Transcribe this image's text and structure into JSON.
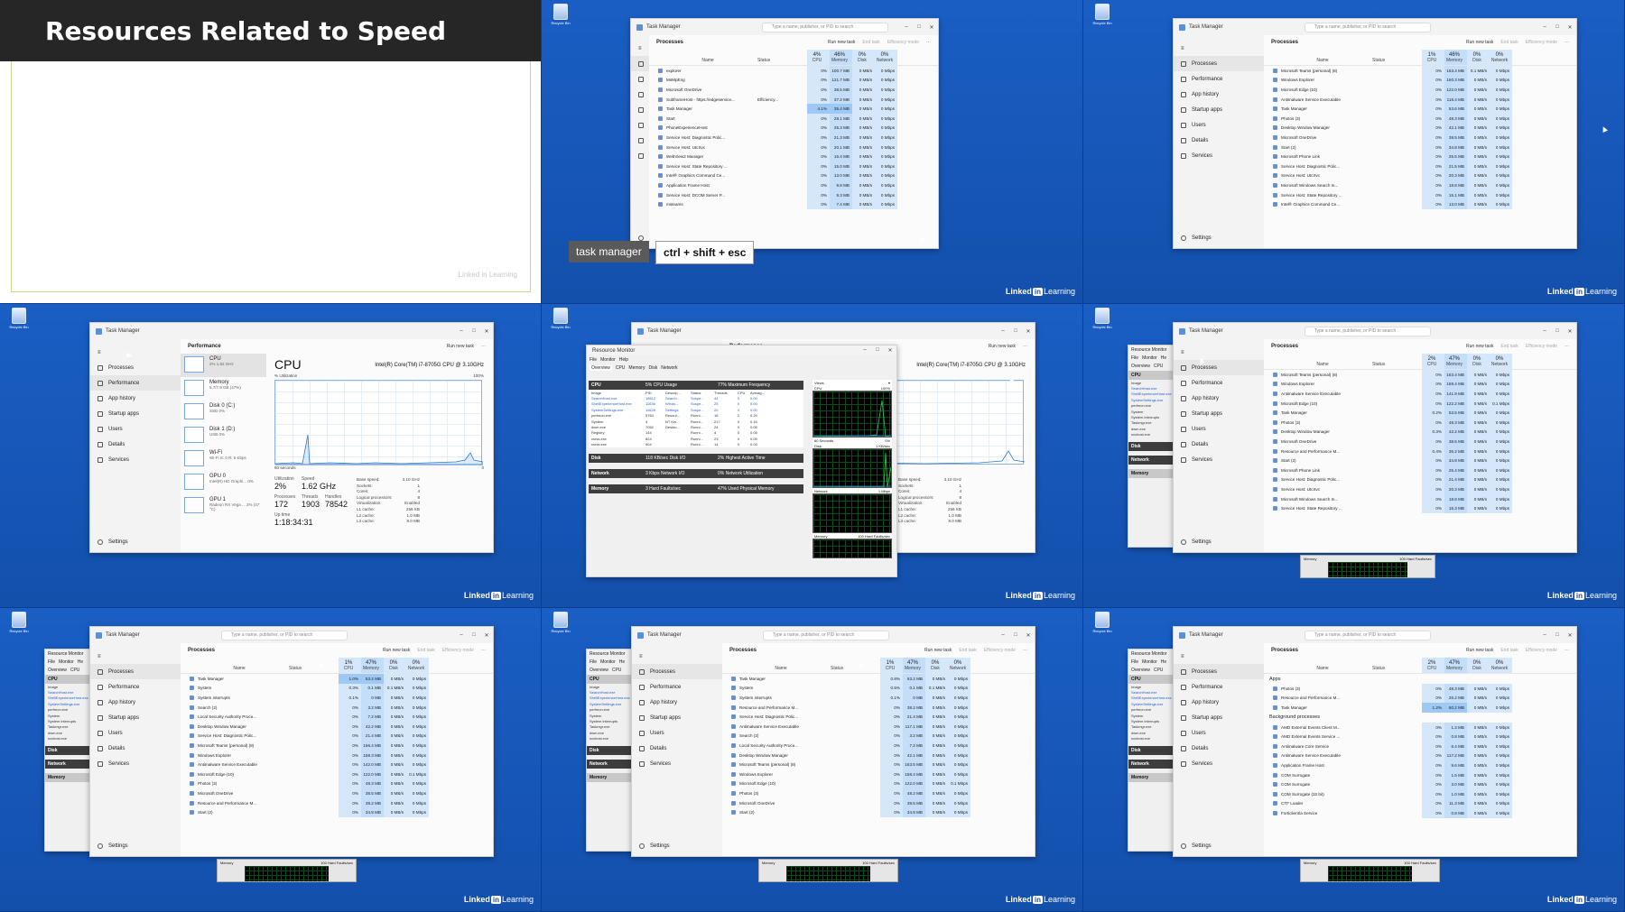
{
  "title_slide": {
    "heading": "Resources Related to Speed",
    "watermark": "Linked in Learning"
  },
  "desktop": {
    "recycle_bin_label": "Recycle Bin",
    "brand_in": "in",
    "brand_linked": "Linked",
    "brand_learning": "Learning"
  },
  "shortcut": {
    "label": "task manager",
    "keys": "ctrl + shift + esc"
  },
  "task_manager": {
    "title": "Task Manager",
    "search_placeholder": "Type a name, publisher, or PID to search",
    "nav": [
      "Processes",
      "Performance",
      "App history",
      "Startup apps",
      "Users",
      "Details",
      "Services"
    ],
    "settings": "Settings",
    "processes_header": "Processes",
    "performance_header": "Performance",
    "actions": {
      "run": "Run new task",
      "end": "End task",
      "eff": "Efficiency mode"
    },
    "cols": {
      "name": "Name",
      "status": "Status",
      "cpu": "CPU",
      "mem": "Memory",
      "disk": "Disk",
      "net": "Network"
    },
    "apps_section": "Apps",
    "bg_section": "Background processes"
  },
  "panel2": {
    "pct": {
      "cpu": "4%",
      "mem": "46%",
      "disk": "0%",
      "net": "0%"
    },
    "rows": [
      [
        "explorer",
        "",
        "0%",
        "100.7 MB",
        "0 MB/s",
        "0 Mbps"
      ],
      [
        "MsMpEng",
        "",
        "0%",
        "121.7 MB",
        "0 MB/s",
        "0 Mbps"
      ],
      [
        "Microsoft OneDrive",
        "",
        "0%",
        "38.5 MB",
        "0 MB/s",
        "0 Mbps"
      ],
      [
        "SubframeHost - https://edgeservice...",
        "Efficiency...",
        "0%",
        "37.2 MB",
        "0 MB/s",
        "0 Mbps"
      ],
      [
        "Task Manager",
        "",
        "4.1%",
        "35.4 MB",
        "0 MB/s",
        "0 Mbps"
      ],
      [
        "Start",
        "",
        "0%",
        "28.1 MB",
        "0 MB/s",
        "0 Mbps"
      ],
      [
        "PhoneExperienceHost",
        "",
        "0%",
        "25.3 MB",
        "0 MB/s",
        "0 Mbps"
      ],
      [
        "Service Host: Diagnostic Polic...",
        "",
        "0%",
        "21.3 MB",
        "0 MB/s",
        "0 Mbps"
      ],
      [
        "Service Host: UtcSvc",
        "",
        "0%",
        "20.1 MB",
        "0 MB/s",
        "0 Mbps"
      ],
      [
        "WebView2 Manager",
        "",
        "0%",
        "16.4 MB",
        "0 MB/s",
        "0 Mbps"
      ],
      [
        "Service Host: State Repository ...",
        "",
        "0%",
        "15.0 MB",
        "0 MB/s",
        "0 Mbps"
      ],
      [
        "Intel® Graphics Command Ce...",
        "",
        "0%",
        "13.0 MB",
        "0 MB/s",
        "0 Mbps"
      ],
      [
        "Application Frame Host",
        "",
        "0%",
        "9.8 MB",
        "0 MB/s",
        "0 Mbps"
      ],
      [
        "Service Host: DCOM Server P...",
        "",
        "0%",
        "9.3 MB",
        "0 MB/s",
        "0 Mbps"
      ],
      [
        "msteams",
        "",
        "0%",
        "7.4 MB",
        "0 MB/s",
        "0 Mbps"
      ]
    ]
  },
  "panel3": {
    "pct": {
      "cpu": "1%",
      "mem": "46%",
      "disk": "0%",
      "net": "0%"
    },
    "rows": [
      [
        "Microsoft Teams (personal) (8)",
        "",
        "0%",
        "163.4 MB",
        "0.1 MB/s",
        "0 Mbps"
      ],
      [
        "Windows Explorer",
        "",
        "0%",
        "160.3 MB",
        "0 MB/s",
        "0 Mbps"
      ],
      [
        "Microsoft Edge (10)",
        "",
        "0%",
        "122.0 MB",
        "0 MB/s",
        "0 Mbps"
      ],
      [
        "Antimalware Service Executable",
        "",
        "0%",
        "118.4 MB",
        "0 MB/s",
        "0 Mbps"
      ],
      [
        "Task Manager",
        "",
        "0%",
        "53.6 MB",
        "0 MB/s",
        "0 Mbps"
      ],
      [
        "Photos (3)",
        "",
        "0%",
        "48.3 MB",
        "0 MB/s",
        "0 Mbps"
      ],
      [
        "Desktop Window Manager",
        "",
        "0%",
        "42.1 MB",
        "0 MB/s",
        "0 Mbps"
      ],
      [
        "Microsoft OneDrive",
        "",
        "0%",
        "38.5 MB",
        "0 MB/s",
        "0 Mbps"
      ],
      [
        "Start (2)",
        "",
        "0%",
        "34.8 MB",
        "0 MB/s",
        "0 Mbps"
      ],
      [
        "Microsoft Phone Link",
        "",
        "0%",
        "25.5 MB",
        "0 MB/s",
        "0 Mbps"
      ],
      [
        "Service Host: Diagnostic Polic...",
        "",
        "0%",
        "21.5 MB",
        "0 MB/s",
        "0 Mbps"
      ],
      [
        "Service Host: UtcSvc",
        "",
        "0%",
        "20.3 MB",
        "0 MB/s",
        "0 Mbps"
      ],
      [
        "Microsoft Windows Search In...",
        "",
        "0%",
        "18.8 MB",
        "0 MB/s",
        "0 Mbps"
      ],
      [
        "Service Host: State Repository ...",
        "",
        "0%",
        "15.1 MB",
        "0 MB/s",
        "0 Mbps"
      ],
      [
        "Intel® Graphics Command Ce...",
        "",
        "0%",
        "13.0 MB",
        "0 MB/s",
        "0 Mbps"
      ]
    ]
  },
  "perf": {
    "list": [
      {
        "name": "CPU",
        "sub": "2%  1.62 GHz"
      },
      {
        "name": "Memory",
        "sub": "5.7/7.9 GB (47%)"
      },
      {
        "name": "Disk 0 (C:)",
        "sub": "SSD  0%"
      },
      {
        "name": "Disk 1 (D:)",
        "sub": "USB  0%"
      },
      {
        "name": "Wi-Fi",
        "sub": "Wi-Fi  S: 0  R: 0 Kbps"
      },
      {
        "name": "GPU 0",
        "sub": "Intel(R) HD Graphi...  0%"
      },
      {
        "name": "GPU 1",
        "sub": "Radeon RX Vega ...  2% (47 °C)"
      }
    ],
    "cpu_title": "CPU",
    "cpu_model": "Intel(R) Core(TM) i7-8705G CPU @ 3.10GHz",
    "util_label": "% Utilization",
    "max_label": "100%",
    "window_label": "60 seconds",
    "min_label": "0",
    "utilization_label": "Utilization",
    "utilization": "2%",
    "speed_label": "Speed",
    "speed": "1.62 GHz",
    "processes_label": "Processes",
    "processes": "172",
    "threads_label": "Threads",
    "threads": "1903",
    "handles_label": "Handles",
    "handles": "78542",
    "uptime_label": "Up time",
    "uptime": "1:18:34:31",
    "specs": [
      [
        "Base speed:",
        "3.10 GHz"
      ],
      [
        "Sockets:",
        "1"
      ],
      [
        "Cores:",
        "4"
      ],
      [
        "Logical processors:",
        "8"
      ],
      [
        "Virtualization:",
        "Enabled"
      ],
      [
        "L1 cache:",
        "256 KB"
      ],
      [
        "L2 cache:",
        "1.0 MB"
      ],
      [
        "L3 cache:",
        "8.0 MB"
      ]
    ]
  },
  "resmon": {
    "title": "Resource Monitor",
    "menu": [
      "File",
      "Monitor",
      "Help"
    ],
    "tabs": [
      "Overview",
      "CPU",
      "Memory",
      "Disk",
      "Network"
    ],
    "cpu_sec": "CPU",
    "cpu_usage": "5% CPU Usage",
    "cpu_freq": "77% Maximum Frequency",
    "cpu_cols": [
      "Image",
      "PID",
      "Descrip...",
      "Status",
      "Threads",
      "CPU",
      "Averag..."
    ],
    "cpu_rows": [
      [
        "SearchHost.exe",
        "18612",
        "Search...",
        "Suspe...",
        "44",
        "0",
        "0.00"
      ],
      [
        "ShellExperienceHost.exe",
        "11636",
        "Windo...",
        "Suspe...",
        "25",
        "0",
        "0.00"
      ],
      [
        "SystemSettings.exe",
        "11628",
        "Settings",
        "Suspe...",
        "20",
        "0",
        "0.00"
      ],
      [
        "perfmon.exe",
        "5764",
        "Resour...",
        "Runni...",
        "16",
        "2",
        "0.29"
      ],
      [
        "System",
        "4",
        "NT Ker...",
        "Runni...",
        "217",
        "0",
        "0.15"
      ],
      [
        "dwm.exe",
        "7052",
        "Deskto...",
        "Runni...",
        "24",
        "0",
        "0.05"
      ],
      [
        "Registry",
        "144",
        "",
        "Runni...",
        "4",
        "0",
        "0.05"
      ],
      [
        "csrss.exe",
        "824",
        "",
        "Runni...",
        "23",
        "0",
        "0.05"
      ],
      [
        "csrss.exe",
        "904",
        "",
        "Runni...",
        "14",
        "0",
        "0.03"
      ]
    ],
    "disk_sec": "Disk",
    "disk_io": "118 KB/sec Disk I/O",
    "disk_time": "2% Highest Active Time",
    "net_sec": "Network",
    "net_io": "3 Kbps Network I/O",
    "net_util": "0% Network Utilization",
    "mem_sec": "Memory",
    "mem_faults": "3 Hard Faults/sec",
    "mem_used": "47% Used Physical Memory",
    "views": "Views",
    "g_cpu": "CPU",
    "g_cpu_max": "100%",
    "g_time": "60 Seconds",
    "g_zero": "0%",
    "g_disk": "Disk",
    "g_disk_max": "1 KB/sec",
    "g_net": "Network",
    "g_net_max": "1 Mbps",
    "g_mem": "Memory",
    "g_mem_max": "100 Hard Faults/sec"
  },
  "panel6": {
    "pct": {
      "cpu": "2%",
      "mem": "47%",
      "disk": "0%",
      "net": "0%"
    },
    "rows": [
      [
        "Microsoft Teams (personal) (8)",
        "",
        "0%",
        "163.4 MB",
        "0 MB/s",
        "0 Mbps"
      ],
      [
        "Windows Explorer",
        "",
        "0%",
        "158.4 MB",
        "0 MB/s",
        "0 Mbps"
      ],
      [
        "Antimalware Service Executable",
        "",
        "0%",
        "141.9 MB",
        "0 MB/s",
        "0 Mbps"
      ],
      [
        "Microsoft Edge (10)",
        "",
        "0%",
        "122.2 MB",
        "0 MB/s",
        "0.1 Mbps"
      ],
      [
        "Task Manager",
        "",
        "0.2%",
        "53.5 MB",
        "0 MB/s",
        "0 Mbps"
      ],
      [
        "Photos (3)",
        "",
        "0%",
        "48.3 MB",
        "0 MB/s",
        "0 Mbps"
      ],
      [
        "Desktop Window Manager",
        "",
        "0.3%",
        "42.2 MB",
        "0 MB/s",
        "0 Mbps"
      ],
      [
        "Microsoft OneDrive",
        "",
        "0%",
        "38.5 MB",
        "0 MB/s",
        "0 Mbps"
      ],
      [
        "Resource and Performance M...",
        "",
        "0.4%",
        "36.2 MB",
        "0 MB/s",
        "0 Mbps"
      ],
      [
        "Start (2)",
        "",
        "0%",
        "34.8 MB",
        "0 MB/s",
        "0 Mbps"
      ],
      [
        "Microsoft Phone Link",
        "",
        "0%",
        "25.4 MB",
        "0 MB/s",
        "0 Mbps"
      ],
      [
        "Service Host: Diagnostic Polic...",
        "",
        "0%",
        "21.4 MB",
        "0 MB/s",
        "0 Mbps"
      ],
      [
        "Service Host: UtcSvc",
        "",
        "0%",
        "20.3 MB",
        "0 MB/s",
        "0 Mbps"
      ],
      [
        "Microsoft Windows Search In...",
        "",
        "0%",
        "18.8 MB",
        "0 MB/s",
        "0 Mbps"
      ],
      [
        "Service Host: State Repository ...",
        "",
        "0%",
        "15.3 MB",
        "0 MB/s",
        "0 Mbps"
      ]
    ]
  },
  "panel7": {
    "pct": {
      "cpu": "1%",
      "mem": "47%",
      "disk": "0%",
      "net": "0%"
    },
    "rows": [
      [
        "Task Manager",
        "",
        "1.0%",
        "53.2 MB",
        "0 MB/s",
        "0 Mbps"
      ],
      [
        "System",
        "",
        "0.3%",
        "0.1 MB",
        "0.1 MB/s",
        "0 Mbps"
      ],
      [
        "System interrupts",
        "",
        "0.1%",
        "0 MB",
        "0 MB/s",
        "0 Mbps"
      ],
      [
        "Search (2)",
        "",
        "0%",
        "3.2 MB",
        "0 MB/s",
        "0 Mbps"
      ],
      [
        "Local Security Authority Proce...",
        "",
        "0%",
        "7.2 MB",
        "0 MB/s",
        "0 Mbps"
      ],
      [
        "Desktop Window Manager",
        "",
        "0%",
        "42.2 MB",
        "0 MB/s",
        "0 Mbps"
      ],
      [
        "Service Host: Diagnostic Polic...",
        "",
        "0%",
        "21.4 MB",
        "0 MB/s",
        "0 Mbps"
      ],
      [
        "Microsoft Teams (personal) (8)",
        "",
        "0%",
        "166.4 MB",
        "0 MB/s",
        "0 Mbps"
      ],
      [
        "Windows Explorer",
        "",
        "0%",
        "158.3 MB",
        "0 MB/s",
        "0 Mbps"
      ],
      [
        "Antimalware Service Executable",
        "",
        "0%",
        "142.0 MB",
        "0 MB/s",
        "0 Mbps"
      ],
      [
        "Microsoft Edge (10)",
        "",
        "0%",
        "122.0 MB",
        "0 MB/s",
        "0.1 Mbps"
      ],
      [
        "Photos (3)",
        "",
        "0%",
        "48.3 MB",
        "0 MB/s",
        "0 Mbps"
      ],
      [
        "Microsoft OneDrive",
        "",
        "0%",
        "38.5 MB",
        "0 MB/s",
        "0 Mbps"
      ],
      [
        "Resource and Performance M...",
        "",
        "0%",
        "38.2 MB",
        "0 MB/s",
        "0 Mbps"
      ],
      [
        "Start (2)",
        "",
        "0%",
        "34.8 MB",
        "0 MB/s",
        "0 Mbps"
      ]
    ]
  },
  "panel8": {
    "pct": {
      "cpu": "1%",
      "mem": "47%",
      "disk": "0%",
      "net": "0%"
    },
    "rows": [
      [
        "Task Manager",
        "",
        "0.8%",
        "63.2 MB",
        "0 MB/s",
        "0 Mbps"
      ],
      [
        "System",
        "",
        "0.5%",
        "0.1 MB",
        "0.1 MB/s",
        "0 Mbps"
      ],
      [
        "System interrupts",
        "",
        "0.1%",
        "0 MB",
        "0 MB/s",
        "0 Mbps"
      ],
      [
        "Resource and Performance M...",
        "",
        "0%",
        "38.2 MB",
        "0 MB/s",
        "0 Mbps"
      ],
      [
        "Service Host: Diagnostic Polic...",
        "",
        "0%",
        "21.4 MB",
        "0 MB/s",
        "0 Mbps"
      ],
      [
        "Antimalware Service Executable",
        "",
        "0%",
        "117.1 MB",
        "0 MB/s",
        "0 Mbps"
      ],
      [
        "Search (2)",
        "",
        "0%",
        "3.2 MB",
        "0 MB/s",
        "0 Mbps"
      ],
      [
        "Local Security Authority Proce...",
        "",
        "0%",
        "7.2 MB",
        "0 MB/s",
        "0 Mbps"
      ],
      [
        "Desktop Window Manager",
        "",
        "0%",
        "42.1 MB",
        "0 MB/s",
        "0 Mbps"
      ],
      [
        "Microsoft Teams (personal) (8)",
        "",
        "0%",
        "163.5 MB",
        "0 MB/s",
        "0 Mbps"
      ],
      [
        "Windows Explorer",
        "",
        "0%",
        "158.4 MB",
        "0 MB/s",
        "0 Mbps"
      ],
      [
        "Microsoft Edge (10)",
        "",
        "0%",
        "122.0 MB",
        "0 MB/s",
        "0.1 Mbps"
      ],
      [
        "Photos (3)",
        "",
        "0%",
        "48.2 MB",
        "0 MB/s",
        "0 Mbps"
      ],
      [
        "Microsoft OneDrive",
        "",
        "0%",
        "38.5 MB",
        "0 MB/s",
        "0 Mbps"
      ],
      [
        "Start (2)",
        "",
        "0%",
        "34.8 MB",
        "0 MB/s",
        "0 Mbps"
      ]
    ]
  },
  "panel9": {
    "pct": {
      "cpu": "2%",
      "mem": "47%",
      "disk": "0%",
      "net": "0%"
    },
    "apps": [
      [
        "Photos (3)",
        "",
        "0%",
        "48.3 MB",
        "0 MB/s",
        "0 Mbps"
      ],
      [
        "Resource and Performance M...",
        "",
        "0%",
        "26.2 MB",
        "0 MB/s",
        "0 Mbps"
      ],
      [
        "Task Manager",
        "",
        "1.2%",
        "60.2 MB",
        "0 MB/s",
        "0 Mbps"
      ]
    ],
    "bg": [
      [
        "AMD External Events Client M...",
        "",
        "0%",
        "1.3 MB",
        "0 MB/s",
        "0 Mbps"
      ],
      [
        "AMD External Events Service ...",
        "",
        "0%",
        "0.8 MB",
        "0 MB/s",
        "0 Mbps"
      ],
      [
        "Antimalware Core Service",
        "",
        "0%",
        "6.4 MB",
        "0 MB/s",
        "0 Mbps"
      ],
      [
        "Antimalware Service Executable",
        "",
        "0%",
        "117.2 MB",
        "0 MB/s",
        "0 Mbps"
      ],
      [
        "Application Frame Host",
        "",
        "0%",
        "9.6 MB",
        "0 MB/s",
        "0 Mbps"
      ],
      [
        "COM Surrogate",
        "",
        "0%",
        "1.5 MB",
        "0 MB/s",
        "0 Mbps"
      ],
      [
        "COM Surrogate",
        "",
        "0%",
        "3.0 MB",
        "0 MB/s",
        "0 Mbps"
      ],
      [
        "COM Surrogate (32 bit)",
        "",
        "0%",
        "1.0 MB",
        "0 MB/s",
        "0 Mbps"
      ],
      [
        "CTF Loader",
        "",
        "0%",
        "11.3 MB",
        "0 MB/s",
        "0 Mbps"
      ],
      [
        "Forticlient/a Service",
        "",
        "0%",
        "0.8 MB",
        "0 MB/s",
        "0 Mbps"
      ]
    ]
  },
  "mini_resmon": {
    "title": "Resource Monitor",
    "menu": [
      "File",
      "Monitor",
      "He"
    ],
    "tabs": [
      "Overview",
      "CPU"
    ],
    "rows": [
      "Image",
      "SearchHost.exe",
      "ShellExperienceHost.exe",
      "SystemSettings.exe",
      "perfmon.exe",
      "System",
      "System interrupts",
      "Taskmgr.exe",
      "dwm.exe",
      "svchost.exe"
    ],
    "sections": [
      "CPU",
      "Disk",
      "Network",
      "Memory"
    ],
    "mem_label": "Memory",
    "mem_max": "100 Hard Faults/sec"
  }
}
